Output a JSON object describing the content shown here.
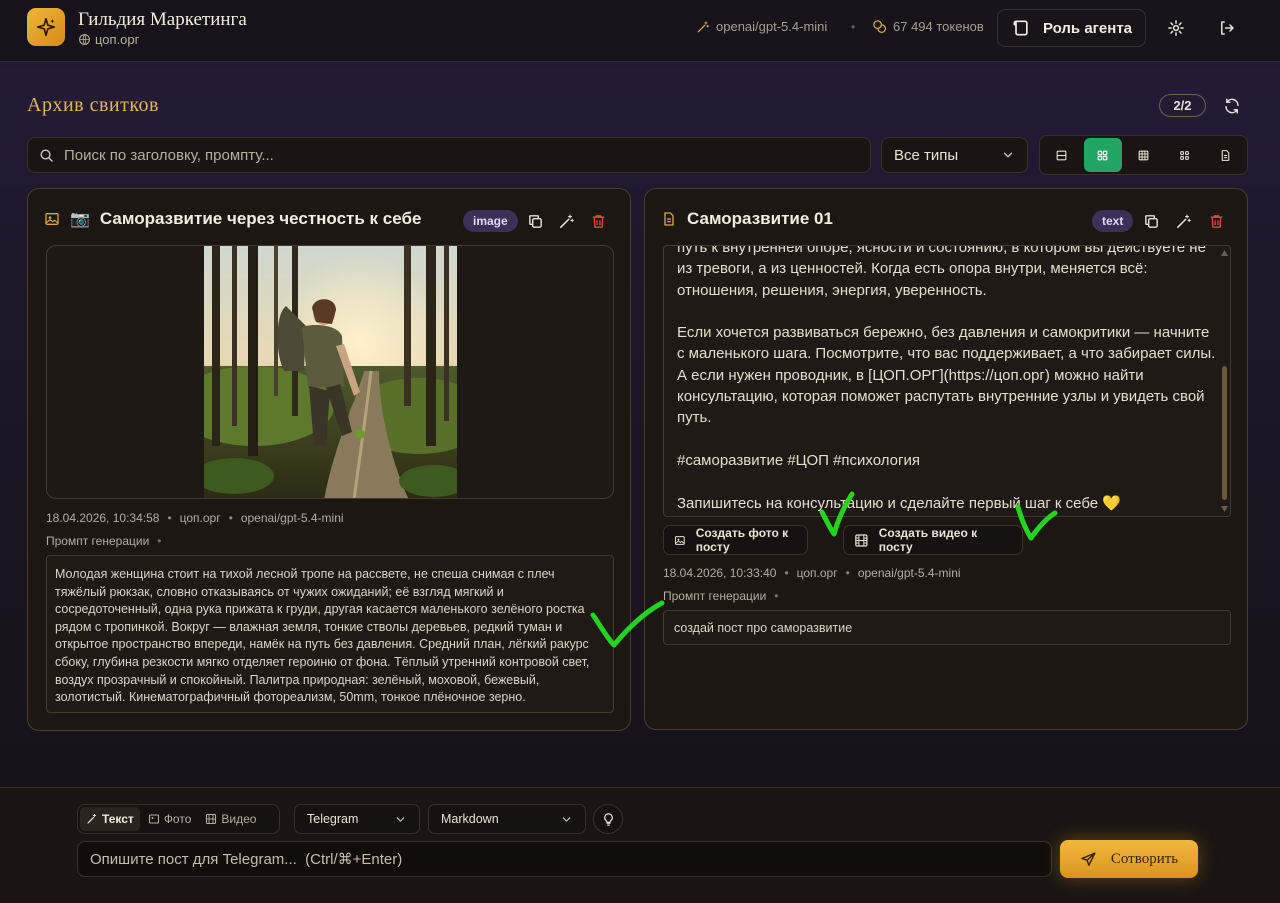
{
  "header": {
    "brand_title": "Гильдия Маркетинга",
    "brand_site": "цоп.орг",
    "model": "openai/gpt-5.4-mini",
    "separator": "•",
    "tokens": "67 494 токенов",
    "role_button": "Роль агента"
  },
  "archive": {
    "title": "Архив свитков",
    "count": "2/2",
    "search_placeholder": "Поиск по заголовку, промпту...",
    "type_filter": "Все типы"
  },
  "cards": [
    {
      "emoji": "📷",
      "title": "Саморазвитие через честность к себе",
      "badge": "image",
      "date": "18.04.2026, 10:34:58",
      "site": "цоп.орг",
      "model": "openai/gpt-5.4-mini",
      "prompt_label": "Промпт генерации",
      "prompt_dot": "•",
      "prompt": "Молодая женщина стоит на тихой лесной тропе на рассвете, не спеша снимая с плеч тяжёлый рюкзак, словно отказываясь от чужих ожиданий; её взгляд мягкий и сосредоточенный, одна рука прижата к груди, другая касается маленького зелёного ростка рядом с тропинкой. Вокруг — влажная земля, тонкие стволы деревьев, редкий туман и открытое пространство впереди, намёк на путь без давления. Средний план, лёгкий ракурс сбоку, глубина резкости мягко отделяет героиню от фона. Тёплый утренний контровой свет, воздух прозрачный и спокойный. Палитра природная: зелёный, моховой, бежевый, золотистый. Кинематографичный фотореализм, 50mm, тонкое плёночное зерно."
    },
    {
      "title": "Саморазвитие 01",
      "badge": "text",
      "body": [
        "путь к внутренней опоре, ясности и состоянию, в котором вы действуете не из тревоги, а из ценностей. Когда есть опора внутри, меняется всё: отношения, решения, энергия, уверенность.",
        "Если хочется развиваться бережно, без давления и самокритики — начните с маленького шага. Посмотрите, что вас поддерживает, а что забирает силы. А если нужен проводник, в [ЦОП.ОРГ](https://цоп.орг) можно найти консультацию, которая поможет распутать внутренние узлы и увидеть свой путь.",
        "#саморазвитие #ЦОП #психология",
        "Запишитесь на консультацию и сделайте первый шаг к себе 💛"
      ],
      "create_photo": "Создать фото к посту",
      "create_video": "Создать видео к посту",
      "date": "18.04.2026, 10:33:40",
      "site": "цоп.орг",
      "model": "openai/gpt-5.4-mini",
      "prompt_label": "Промпт генерации",
      "prompt_dot": "•",
      "prompt": "создай пост про саморазвитие"
    }
  ],
  "composer": {
    "modes": [
      "Текст",
      "Фото",
      "Видео"
    ],
    "platform": "Telegram",
    "format": "Markdown",
    "input_placeholder": "Опишите пост для Telegram...  (Ctrl/⌘+Enter)",
    "submit": "Сотворить"
  },
  "colors": {
    "accent_gold": "#e3b556",
    "active_view": "#22a462",
    "delete_red": "#d94a3a",
    "badge_purple": "#3d2f57",
    "check_green": "#22d41e"
  }
}
